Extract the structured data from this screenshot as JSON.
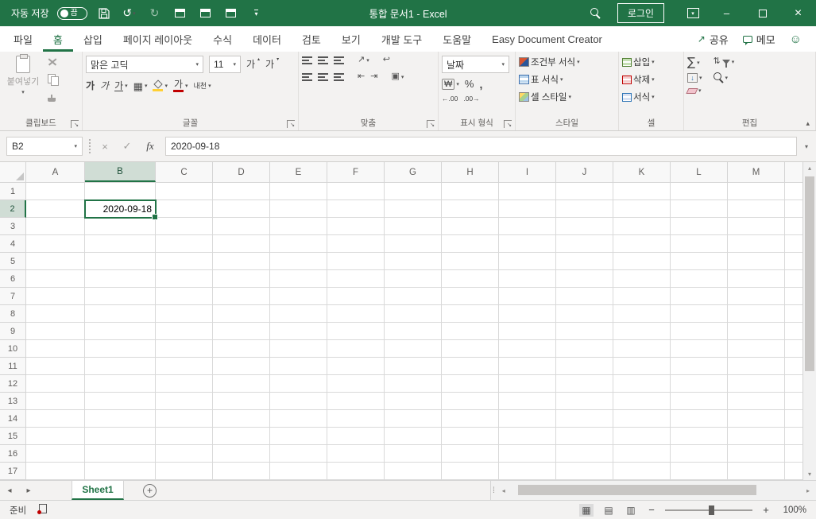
{
  "colors": {
    "accent": "#217346",
    "titlebar": "#217346",
    "selection_border": "#217346"
  },
  "title_bar": {
    "autosave_label": "자동 저장",
    "autosave_state": "끔",
    "title": "통합 문서1 - Excel",
    "login_label": "로그인"
  },
  "ribbon_tabs": [
    "파일",
    "홈",
    "삽입",
    "페이지 레이아웃",
    "수식",
    "데이터",
    "검토",
    "보기",
    "개발 도구",
    "도움말",
    "Easy Document Creator"
  ],
  "ribbon_actions": {
    "share_label": "공유",
    "comments_label": "메모",
    "smiley": "☺"
  },
  "ribbon": {
    "clipboard": {
      "paste_label": "붙여넣기",
      "group_label": "클립보드"
    },
    "font": {
      "font_name": "맑은 고딕",
      "font_size": "11",
      "grow": "가",
      "shrink": "가",
      "bold": "가",
      "italic": "가",
      "underline": "가",
      "font_color": "가",
      "border_icon": "▦",
      "phonetic": "내천",
      "group_label": "글꼴"
    },
    "alignment": {
      "orientation_icon": "↗",
      "wrap_icon": "↩",
      "indent_dec": "⇤",
      "indent_inc": "⇥",
      "merge_icon": "▣",
      "group_label": "맞춤"
    },
    "number": {
      "format": "날짜",
      "currency": "₩",
      "percent": "%",
      "comma": ",",
      "inc_decimal": "←.00",
      "dec_decimal": ".00→",
      "group_label": "표시 형식"
    },
    "styles": {
      "conditional_label": "조건부 서식",
      "table_label": "표 서식",
      "cellstyles_label": "셀 스타일",
      "group_label": "스타일"
    },
    "cells": {
      "insert_label": "삽입",
      "delete_label": "삭제",
      "format_label": "서식",
      "group_label": "셀"
    },
    "editing": {
      "autosum": "∑",
      "sort_icon": "⇅",
      "fill_icon": "↓",
      "group_label": "편집"
    }
  },
  "formula_bar": {
    "name_box": "B2",
    "cancel_icon": "×",
    "enter_icon": "✓",
    "fx_label": "fx",
    "value": "2020-09-18"
  },
  "grid": {
    "columns": [
      "A",
      "B",
      "C",
      "D",
      "E",
      "F",
      "G",
      "H",
      "I",
      "J",
      "K",
      "L",
      "M"
    ],
    "rows": [
      "1",
      "2",
      "3",
      "4",
      "5",
      "6",
      "7",
      "8",
      "9",
      "10",
      "11",
      "12",
      "13",
      "14",
      "15",
      "16",
      "17"
    ],
    "selection": {
      "cell": "B2",
      "value": "2020-09-18"
    }
  },
  "sheet_tabs": {
    "active_tab": "Sheet1"
  },
  "status_bar": {
    "ready_label": "준비",
    "zoom_level": "100%"
  }
}
